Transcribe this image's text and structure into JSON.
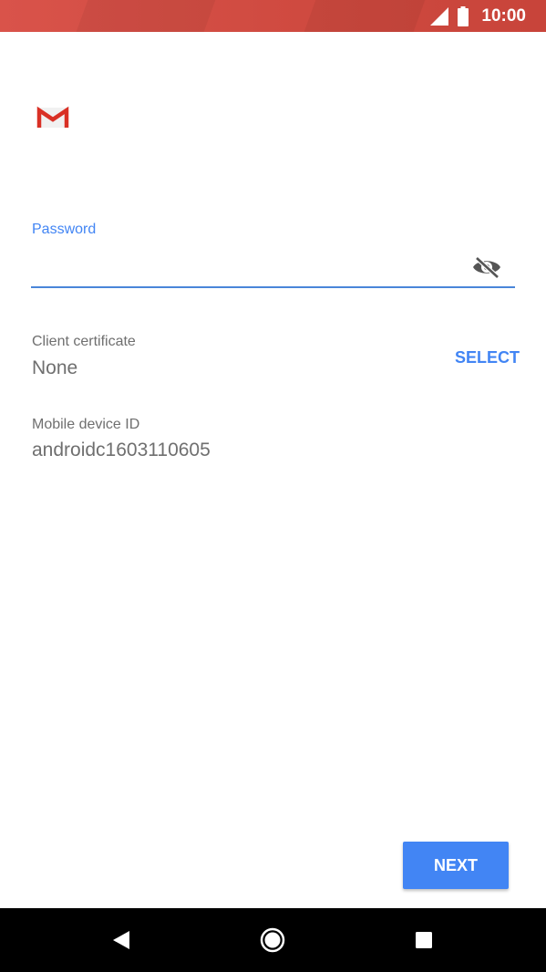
{
  "status_bar": {
    "time": "10:00",
    "background_color": "#d9534a",
    "icons": [
      "cell-signal-icon",
      "battery-icon"
    ]
  },
  "app": {
    "logo_icon": "gmail-logo-icon"
  },
  "password": {
    "label": "Password",
    "value": "",
    "toggle_icon": "visibility-off-icon",
    "accent_color": "#4285f4"
  },
  "client_certificate": {
    "label": "Client certificate",
    "value": "None",
    "select_label": "SELECT"
  },
  "mobile_device": {
    "label": "Mobile device ID",
    "value": "androidc1603110605"
  },
  "actions": {
    "next_label": "NEXT"
  },
  "nav_bar": {
    "icons": [
      "back-icon",
      "home-icon",
      "recents-icon"
    ]
  }
}
